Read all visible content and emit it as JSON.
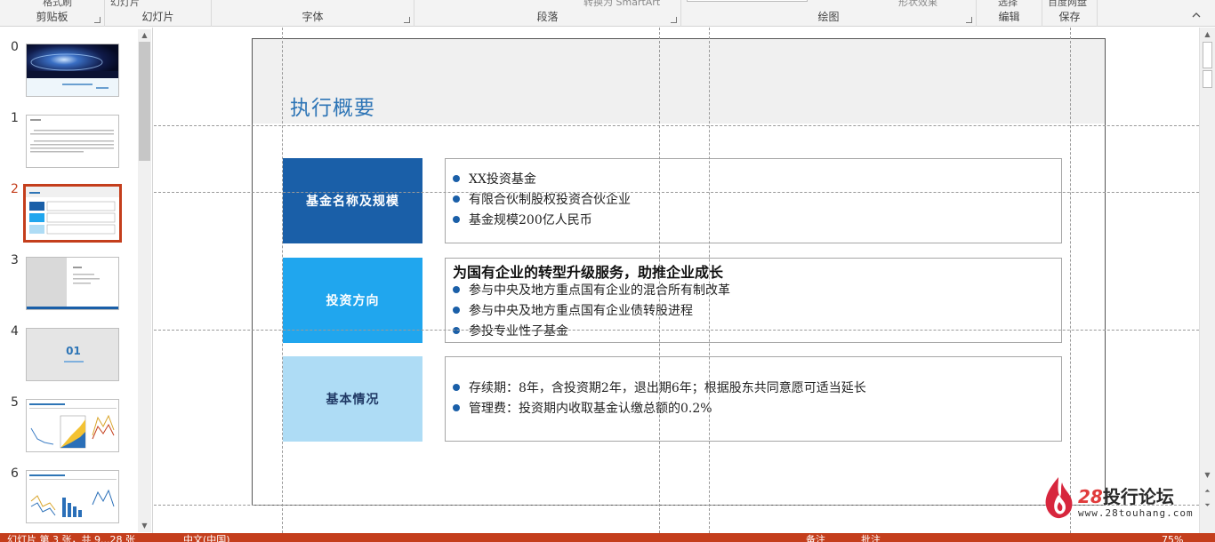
{
  "ribbon": {
    "groups": [
      {
        "label": "剪贴板",
        "top_text": "格式刷"
      },
      {
        "label": "幻灯片",
        "top_text": "幻灯片"
      },
      {
        "label": "字体",
        "top_text": ""
      },
      {
        "label": "段落",
        "top_text": "转换为 SmartArt"
      },
      {
        "label": "绘图",
        "top_text": "形状效果"
      },
      {
        "label": "编辑",
        "top_text": "选择"
      },
      {
        "label": "保存",
        "top_text": "百度网盘"
      }
    ]
  },
  "thumbnails": {
    "active_index": 2,
    "items": [
      {
        "number": "0"
      },
      {
        "number": "1"
      },
      {
        "number": "2"
      },
      {
        "number": "3"
      },
      {
        "number": "4",
        "text": "01"
      },
      {
        "number": "5"
      },
      {
        "number": "6"
      }
    ]
  },
  "slide": {
    "title": "执行概要",
    "rows": [
      {
        "label": "基金名称及规模",
        "label_bg": "#1a5fa8",
        "label_color": "#ffffff",
        "heading": "",
        "bullets": [
          "XX投资基金",
          "有限合伙制股权投资合伙企业",
          "基金规模200亿人民币"
        ]
      },
      {
        "label": "投资方向",
        "label_bg": "#20a6ee",
        "label_color": "#ffffff",
        "heading": "为国有企业的转型升级服务，助推企业成长",
        "bullets": [
          "参与中央及地方重点国有企业的混合所有制改革",
          "参与中央及地方重点国有企业债转股进程",
          "参投专业性子基金"
        ]
      },
      {
        "label": "基本情况",
        "label_bg": "#aedcf5",
        "label_color": "#1f3864",
        "heading": "",
        "bullets": [
          "存续期：8年，含投资期2年，退出期6年；根据股东共同意愿可适当延长",
          "管理费：投资期内收取基金认缴总额的0.2%"
        ]
      }
    ]
  },
  "watermark": {
    "brand_num": "28",
    "brand_text": "投行论坛",
    "url": "www.28touhang.com"
  },
  "statusbar": {
    "slide_info": "幻灯片 第 3 张，共 9...28 张",
    "language": "中文(中国)",
    "notes": "备注",
    "comments": "批注",
    "zoom": "75%"
  }
}
